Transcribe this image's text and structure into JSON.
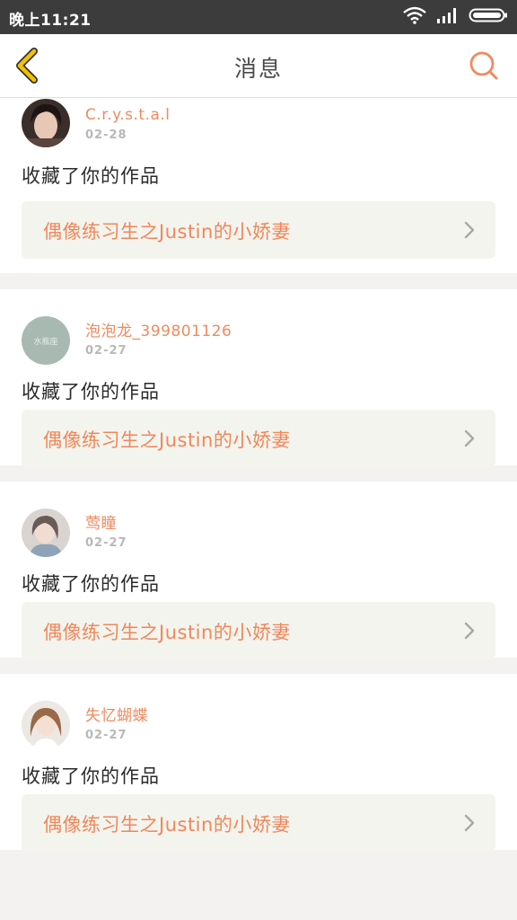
{
  "status_bar": {
    "time": "晚上11:21",
    "icons": [
      "wifi-icon",
      "signal-icon",
      "battery-icon"
    ]
  },
  "nav": {
    "title": "消息",
    "back_icon": "chevron-left-icon",
    "search_icon": "search-icon"
  },
  "colors": {
    "accent": "#f08a5d",
    "back_icon": "#f2c200",
    "status_bar": "#3c3c3c",
    "card_link_bg": "#f4f4ee"
  },
  "messages": [
    {
      "username": "C.r.y.s.t.a.l",
      "date": "02-28",
      "action": "收藏了你的作品",
      "work_title": "偶像练习生之Justin的小娇妻"
    },
    {
      "username": "泡泡龙_399801126",
      "date": "02-27",
      "action": "收藏了你的作品",
      "work_title": "偶像练习生之Justin的小娇妻",
      "avatar_text": "水瓶座"
    },
    {
      "username": "莺瞳",
      "date": "02-27",
      "action": "收藏了你的作品",
      "work_title": "偶像练习生之Justin的小娇妻"
    },
    {
      "username": "失忆蝴蝶",
      "date": "02-27",
      "action": "收藏了你的作品",
      "work_title": "偶像练习生之Justin的小娇妻"
    }
  ]
}
